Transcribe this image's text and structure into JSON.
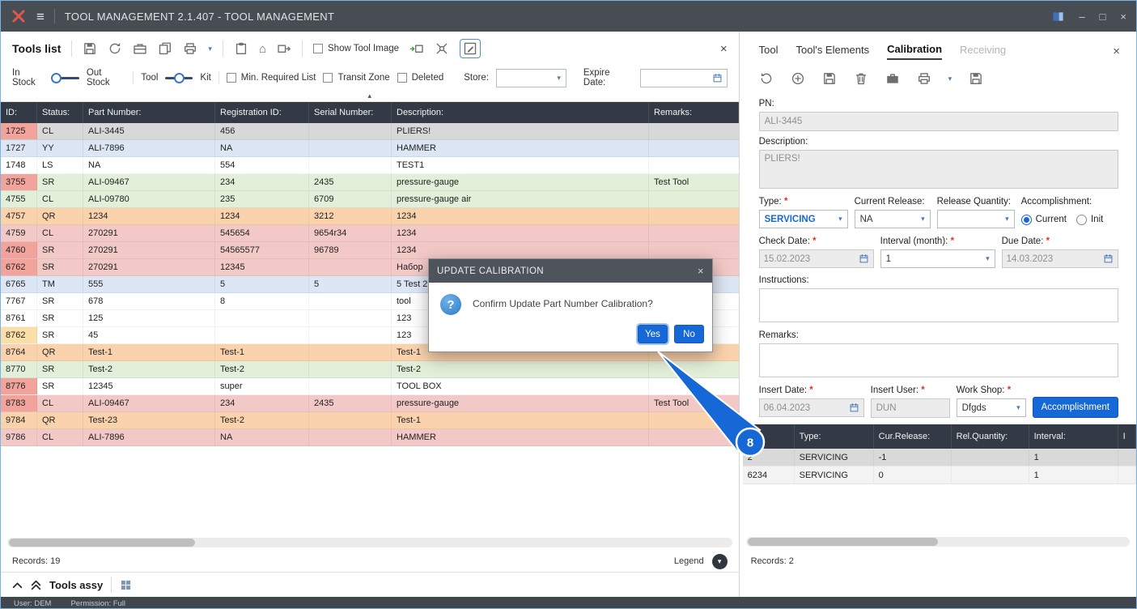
{
  "window": {
    "title": "TOOL MANAGEMENT 2.1.407 - TOOL MANAGEMENT",
    "user": "User: DEM",
    "permission": "Permission: Full"
  },
  "icons": {
    "close": "×",
    "caret_down": "▾",
    "collapse_up": "▴",
    "home": "⌂",
    "hamburger": "≡",
    "minimize": "–",
    "maximize": "□",
    "chevron_down": "▾",
    "question_mark": "?",
    "left_toolbar": [
      "save-icon",
      "refresh-icon",
      "toolbox-icon",
      "copy-icon",
      "print-icon",
      "paste-icon",
      "home-icon",
      "dispatch-icon",
      "import-icon",
      "find-tool-icon",
      "edit-icon"
    ],
    "right_toolbar": [
      "undo-icon",
      "add-icon",
      "save-icon",
      "delete-icon",
      "case-icon",
      "print-icon",
      "export-icon"
    ]
  },
  "colors": {
    "accent_blue": "#1668d6",
    "grid_header": "#333a46",
    "row_selected": "#d8d8d8",
    "row_blue": "#dce6f4",
    "row_green": "#e2efd9",
    "row_orange": "#fad3ad",
    "row_pink": "#f2c9c7",
    "id_red": "#f2a49c",
    "id_orange": "#fbdfa8"
  },
  "tools_list": {
    "title": "Tools list",
    "show_tool_image": "Show Tool Image",
    "filters": {
      "in_stock": "In Stock",
      "out_stock": "Out Stock",
      "tool": "Tool",
      "kit": "Kit",
      "min_required_list": "Min. Required List",
      "transit_zone": "Transit Zone",
      "deleted": "Deleted",
      "store_label": "Store:",
      "store_value": "",
      "expire_date_label": "Expire Date:",
      "expire_date_value": ""
    },
    "grid": {
      "columns": [
        "ID:",
        "Status:",
        "Part Number:",
        "Registration ID:",
        "Serial Number:",
        "Description:",
        "Remarks:"
      ],
      "rows": [
        {
          "id": "1725",
          "status": "CL",
          "part_number": "ALI-3445",
          "registration_id": "456",
          "serial_number": "",
          "description": "PLIERS!",
          "remarks": "",
          "row_bg": "#d8d8d8",
          "id_bg": "#f2a49c",
          "selected": true
        },
        {
          "id": "1727",
          "status": "YY",
          "part_number": "ALI-7896",
          "registration_id": "NA",
          "serial_number": "",
          "description": "HAMMER",
          "remarks": "",
          "row_bg": "#dce6f4"
        },
        {
          "id": "1748",
          "status": "LS",
          "part_number": "NA",
          "registration_id": "554",
          "serial_number": "",
          "description": "TEST1",
          "remarks": "",
          "row_bg": "#ffffff"
        },
        {
          "id": "3755",
          "status": "SR",
          "part_number": "ALI-09467",
          "registration_id": "234",
          "serial_number": "2435",
          "description": "pressure-gauge",
          "remarks": "Test Tool",
          "row_bg": "#e2efd9",
          "id_bg": "#f2a49c"
        },
        {
          "id": "4755",
          "status": "CL",
          "part_number": "ALI-09780",
          "registration_id": "235",
          "serial_number": "6709",
          "description": "pressure-gauge air",
          "remarks": "",
          "row_bg": "#e2efd9"
        },
        {
          "id": "4757",
          "status": "QR",
          "part_number": "1234",
          "registration_id": "1234",
          "serial_number": "3212",
          "description": "1234",
          "remarks": "",
          "row_bg": "#fad3ad"
        },
        {
          "id": "4759",
          "status": "CL",
          "part_number": "270291",
          "registration_id": "545654",
          "serial_number": "9654r34",
          "description": "1234",
          "remarks": "",
          "row_bg": "#f2c9c7"
        },
        {
          "id": "4760",
          "status": "SR",
          "part_number": "270291",
          "registration_id": "54565577",
          "serial_number": "96789",
          "description": "1234",
          "remarks": "",
          "row_bg": "#f2c9c7",
          "id_bg": "#f2a49c"
        },
        {
          "id": "6762",
          "status": "SR",
          "part_number": "270291",
          "registration_id": "12345",
          "serial_number": "",
          "description": "Набор",
          "remarks": "",
          "row_bg": "#f2c9c7",
          "id_bg": "#f2a49c"
        },
        {
          "id": "6765",
          "status": "TM",
          "part_number": "555",
          "registration_id": "5",
          "serial_number": "5",
          "description": "5 Test 2",
          "remarks": "",
          "row_bg": "#dce6f4"
        },
        {
          "id": "7767",
          "status": "SR",
          "part_number": "678",
          "registration_id": "8",
          "serial_number": "",
          "description": "tool",
          "remarks": "",
          "row_bg": "#ffffff"
        },
        {
          "id": "8761",
          "status": "SR",
          "part_number": "125",
          "registration_id": "",
          "serial_number": "",
          "description": "123",
          "remarks": "",
          "row_bg": "#ffffff"
        },
        {
          "id": "8762",
          "status": "SR",
          "part_number": "45",
          "registration_id": "",
          "serial_number": "",
          "description": "123",
          "remarks": "",
          "row_bg": "#ffffff",
          "id_bg": "#fbdfa8"
        },
        {
          "id": "8764",
          "status": "QR",
          "part_number": "Test-1",
          "registration_id": "Test-1",
          "serial_number": "",
          "description": "Test-1",
          "remarks": "",
          "row_bg": "#fad3ad"
        },
        {
          "id": "8770",
          "status": "SR",
          "part_number": "Test-2",
          "registration_id": "Test-2",
          "serial_number": "",
          "description": "Test-2",
          "remarks": "",
          "row_bg": "#e2efd9"
        },
        {
          "id": "8776",
          "status": "SR",
          "part_number": "12345",
          "registration_id": "super",
          "serial_number": "",
          "description": "TOOL BOX",
          "remarks": "",
          "row_bg": "#ffffff",
          "id_bg": "#f2a49c"
        },
        {
          "id": "8783",
          "status": "CL",
          "part_number": "ALI-09467",
          "registration_id": "234",
          "serial_number": "2435",
          "description": "pressure-gauge",
          "remarks": "Test Tool",
          "row_bg": "#f2c9c7",
          "id_bg": "#f2a49c"
        },
        {
          "id": "9784",
          "status": "QR",
          "part_number": "Test-23",
          "registration_id": "Test-2",
          "serial_number": "",
          "description": "Test-1",
          "remarks": "",
          "row_bg": "#fad3ad"
        },
        {
          "id": "9786",
          "status": "CL",
          "part_number": "ALI-7896",
          "registration_id": "NA",
          "serial_number": "",
          "description": "HAMMER",
          "remarks": "",
          "row_bg": "#f2c9c7"
        }
      ]
    },
    "records": "Records: 19",
    "legend_label": "Legend"
  },
  "tools_assy": {
    "title": "Tools assy"
  },
  "dialog": {
    "title": "UPDATE CALIBRATION",
    "message": "Confirm Update Part Number Calibration?",
    "yes_label": "Yes",
    "no_label": "No"
  },
  "annotation": {
    "step_number": "8"
  },
  "detail": {
    "tabs": [
      {
        "label": "Tool"
      },
      {
        "label": "Tool's Elements"
      },
      {
        "label": "Calibration",
        "active": true
      },
      {
        "label": "Receiving",
        "disabled": true
      }
    ],
    "required_marker": "*",
    "pn": {
      "label": "PN:",
      "value": "ALI-3445"
    },
    "description": {
      "label": "Description:",
      "value": "PLIERS!"
    },
    "type": {
      "label": "Type:",
      "value": "SERVICING"
    },
    "current_release": {
      "label": "Current Release:",
      "value": "NA"
    },
    "release_quantity": {
      "label": "Release Quantity:",
      "value": ""
    },
    "accomplishment": {
      "label": "Accomplishment:",
      "options": [
        "Current",
        "Init"
      ],
      "selected": "Current"
    },
    "check_date": {
      "label": "Check Date:",
      "value": "15.02.2023"
    },
    "interval": {
      "label": "Interval (month):",
      "value": "1"
    },
    "due_date": {
      "label": "Due Date:",
      "value": "14.03.2023"
    },
    "instructions": {
      "label": "Instructions:",
      "value": ""
    },
    "remarks": {
      "label": "Remarks:",
      "value": ""
    },
    "insert_date": {
      "label": "Insert Date:",
      "value": "06.04.2023"
    },
    "insert_user": {
      "label": "Insert User:",
      "value": "DUN"
    },
    "work_shop": {
      "label": "Work Shop:",
      "value": "Dfgds"
    },
    "accomplishment_button": "Accomplishment",
    "grid": {
      "columns": [
        "",
        "Type:",
        "Cur.Release:",
        "Rel.Quantity:",
        "Interval:",
        "I"
      ],
      "rows": [
        {
          "id": "2",
          "type": "SERVICING",
          "cur_release": "-1",
          "rel_quantity": "",
          "interval": "1",
          "extra": "",
          "selected": true
        },
        {
          "id": "6234",
          "type": "SERVICING",
          "cur_release": "0",
          "rel_quantity": "",
          "interval": "1",
          "extra": ""
        }
      ]
    },
    "records": "Records: 2"
  }
}
